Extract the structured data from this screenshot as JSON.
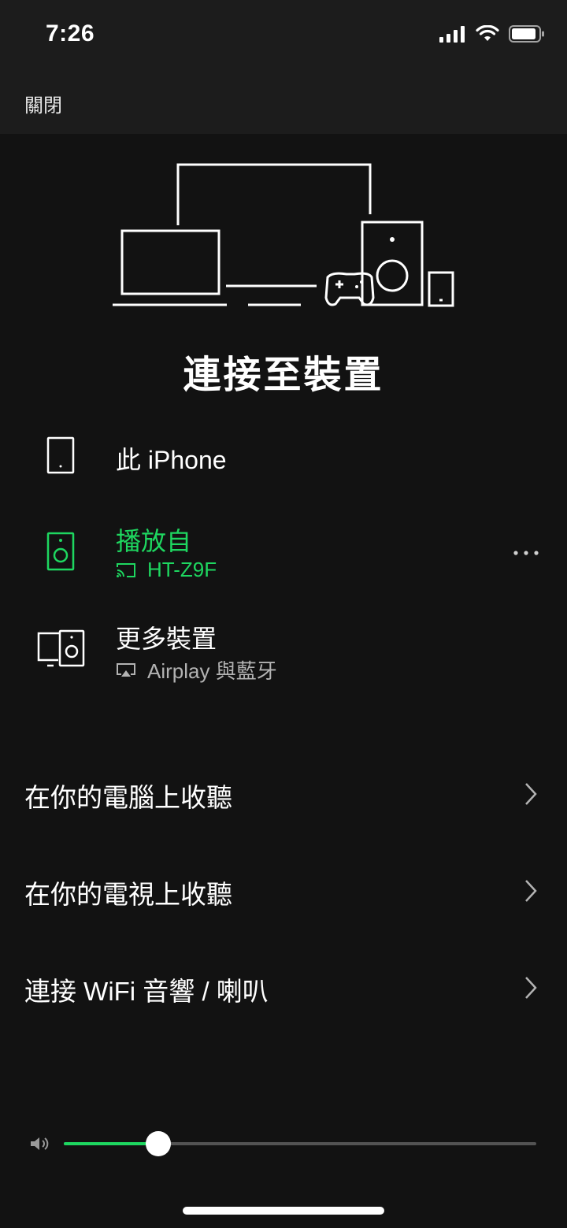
{
  "status_bar": {
    "time": "7:26"
  },
  "header": {
    "close_label": "關閉"
  },
  "title": "連接至裝置",
  "devices": [
    {
      "title": "此 iPhone",
      "subtitle": "",
      "icon": "phone-icon"
    },
    {
      "title": "播放自",
      "subtitle": "HT-Z9F",
      "icon": "speaker-icon",
      "sub_icon": "cast-icon"
    },
    {
      "title": "更多裝置",
      "subtitle": "Airplay 與藍牙",
      "icon": "devices-icon",
      "sub_icon": "airplay-icon"
    }
  ],
  "list": [
    {
      "label": "在你的電腦上收聽"
    },
    {
      "label": "在你的電視上收聽"
    },
    {
      "label": "連接 WiFi 音響 / 喇叭"
    }
  ],
  "volume": {
    "level": 0.2
  },
  "colors": {
    "accent": "#1ed760",
    "background": "#121212",
    "header": "#1c1c1c"
  }
}
